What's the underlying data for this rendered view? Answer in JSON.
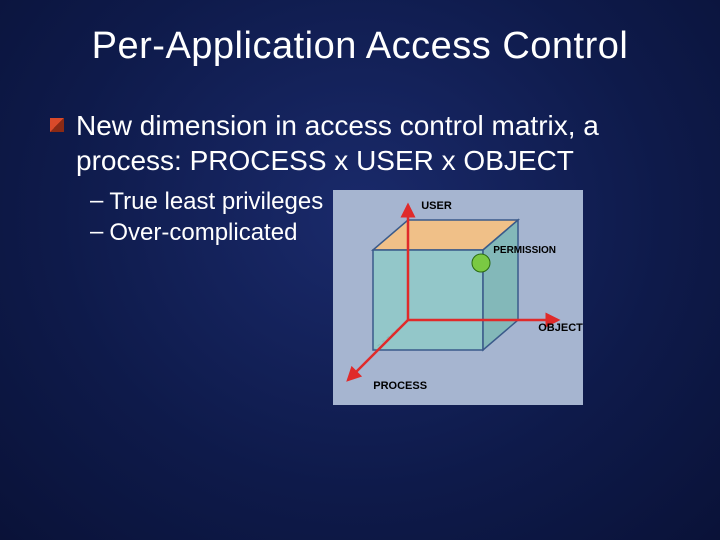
{
  "title": "Per-Application Access Control",
  "main_bullet": "New dimension in access control matrix, a process: PROCESS x USER x OBJECT",
  "sub_bullets": [
    "True least privileges",
    "Over-complicated"
  ],
  "diagram": {
    "axis_user": "USER",
    "axis_object": "OBJECT",
    "axis_process": "PROCESS",
    "point_label": "PERMISSION"
  }
}
